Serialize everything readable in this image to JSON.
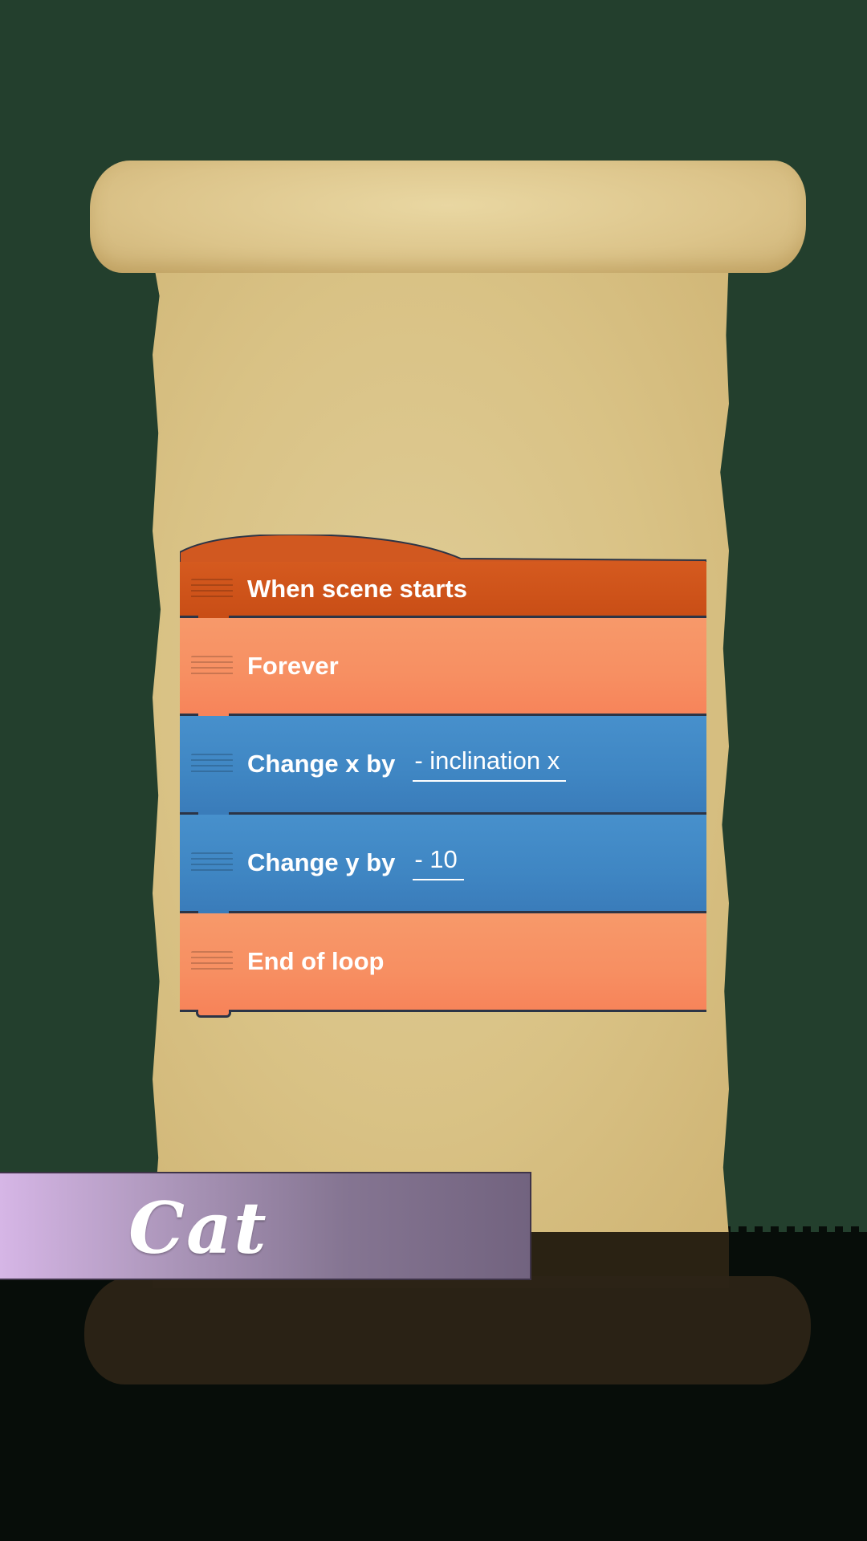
{
  "script": {
    "blocks": [
      {
        "type": "event",
        "label": "When scene starts",
        "color": "#cf551b"
      },
      {
        "type": "control",
        "label": "Forever",
        "color": "#f7915f"
      },
      {
        "type": "motion",
        "label": "Change x by",
        "value": "- inclination x",
        "color": "#4189c6"
      },
      {
        "type": "motion",
        "label": "Change y by",
        "value": "- 10",
        "color": "#4189c6"
      },
      {
        "type": "control",
        "label": "End of loop",
        "color": "#f7915f"
      }
    ]
  },
  "sprite": {
    "name": "Cat"
  },
  "colors": {
    "background": "#233f2d",
    "scroll": "#dcc48a",
    "banner_start": "#d6b6e6",
    "banner_end": "#72637f"
  }
}
